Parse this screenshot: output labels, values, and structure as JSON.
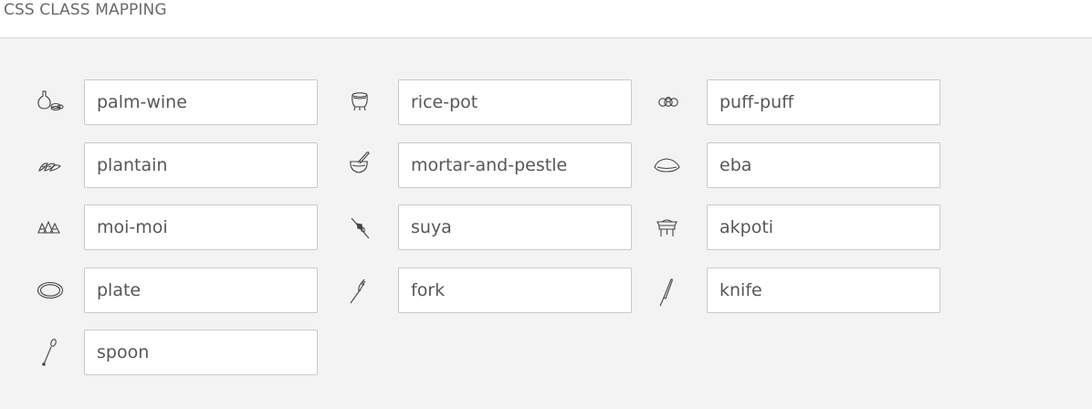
{
  "header": {
    "title": "CSS CLASS MAPPING"
  },
  "items": [
    {
      "icon": "palm-wine-icon",
      "value": "palm-wine"
    },
    {
      "icon": "rice-pot-icon",
      "value": "rice-pot"
    },
    {
      "icon": "puff-puff-icon",
      "value": "puff-puff"
    },
    {
      "icon": "plantain-icon",
      "value": "plantain"
    },
    {
      "icon": "mortar-and-pestle-icon",
      "value": "mortar-and-pestle"
    },
    {
      "icon": "eba-icon",
      "value": "eba"
    },
    {
      "icon": "moi-moi-icon",
      "value": "moi-moi"
    },
    {
      "icon": "suya-icon",
      "value": "suya"
    },
    {
      "icon": "akpoti-icon",
      "value": "akpoti"
    },
    {
      "icon": "plate-icon",
      "value": "plate"
    },
    {
      "icon": "fork-icon",
      "value": "fork"
    },
    {
      "icon": "knife-icon",
      "value": "knife"
    },
    {
      "icon": "spoon-icon",
      "value": "spoon"
    }
  ]
}
